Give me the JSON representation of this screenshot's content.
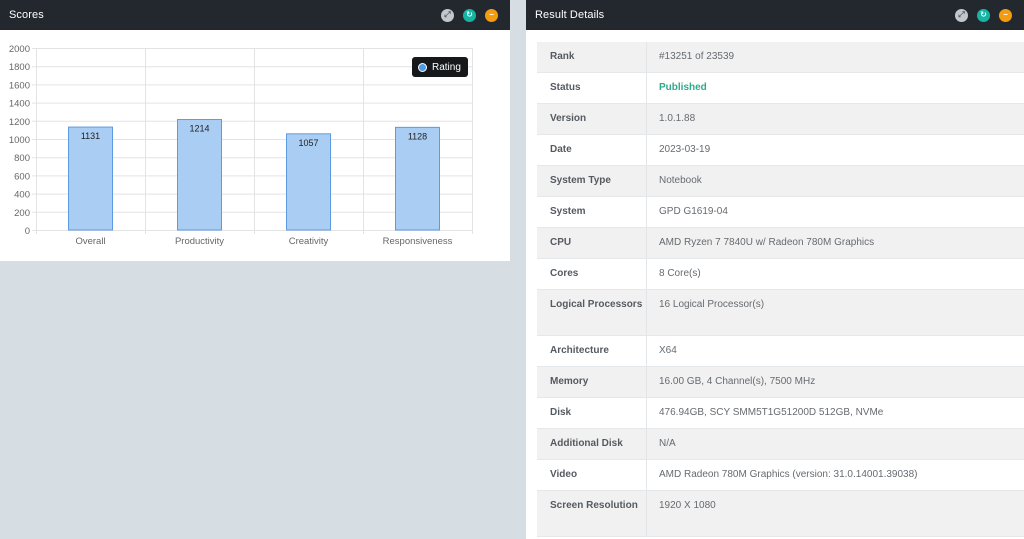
{
  "scores": {
    "title": "Scores",
    "legend_label": "Rating",
    "icons": [
      "expand-icon",
      "refresh-icon",
      "minimize-icon"
    ]
  },
  "chart_data": {
    "type": "bar",
    "categories": [
      "Overall",
      "Productivity",
      "Creativity",
      "Responsiveness"
    ],
    "series": [
      {
        "name": "Rating",
        "values": [
          1131,
          1214,
          1057,
          1128
        ]
      }
    ],
    "ylim": [
      0,
      2000
    ],
    "yticks": [
      0,
      200,
      400,
      600,
      800,
      1000,
      1200,
      1400,
      1600,
      1800,
      2000
    ],
    "bar_fill": "#aacdf3",
    "bar_stroke": "#5d9be0",
    "grid": true,
    "legend_position": "top-right"
  },
  "results": {
    "title": "Result Details",
    "rows": [
      {
        "label": "Rank",
        "value": "#13251 of 23539"
      },
      {
        "label": "Status",
        "value": "Published"
      },
      {
        "label": "Version",
        "value": "1.0.1.88"
      },
      {
        "label": "Date",
        "value": "2023-03-19"
      },
      {
        "label": "System Type",
        "value": "Notebook"
      },
      {
        "label": "System",
        "value": "GPD G1619-04"
      },
      {
        "label": "CPU",
        "value": "AMD Ryzen 7 7840U w/ Radeon 780M Graphics"
      },
      {
        "label": "Cores",
        "value": "8 Core(s)"
      },
      {
        "label": "Logical Processors",
        "value": "16 Logical Processor(s)"
      },
      {
        "label": "Architecture",
        "value": "X64"
      },
      {
        "label": "Memory",
        "value": "16.00 GB, 4 Channel(s), 7500 MHz"
      },
      {
        "label": "Disk",
        "value": "476.94GB, SCY SMM5T1G51200D 512GB, NVMe"
      },
      {
        "label": "Additional Disk",
        "value": "N/A"
      },
      {
        "label": "Video",
        "value": "AMD Radeon 780M Graphics (version: 31.0.14001.39038)"
      },
      {
        "label": "Screen Resolution",
        "value": "1920 X 1080"
      }
    ]
  },
  "colors": {
    "header_bg": "#23282f",
    "page_bg": "#d6dde3",
    "status_published": "#2faa88",
    "icon_teal": "#17b3a3",
    "icon_orange": "#f39c12"
  }
}
